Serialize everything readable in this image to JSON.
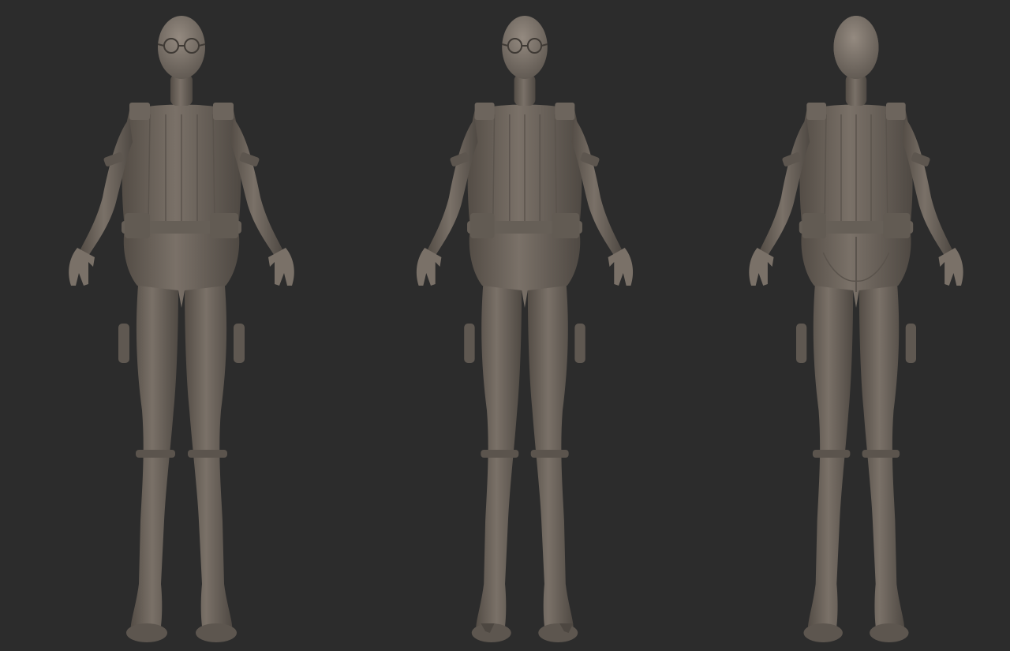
{
  "scene": {
    "background_color": "#2c2c2c",
    "clay_color": "#6e665e",
    "clay_light_color": "#8c837a",
    "clay_dark_color": "#4d4741",
    "views": [
      {
        "name": "front",
        "label": ""
      },
      {
        "name": "three-quarter",
        "label": ""
      },
      {
        "name": "back",
        "label": ""
      }
    ]
  }
}
